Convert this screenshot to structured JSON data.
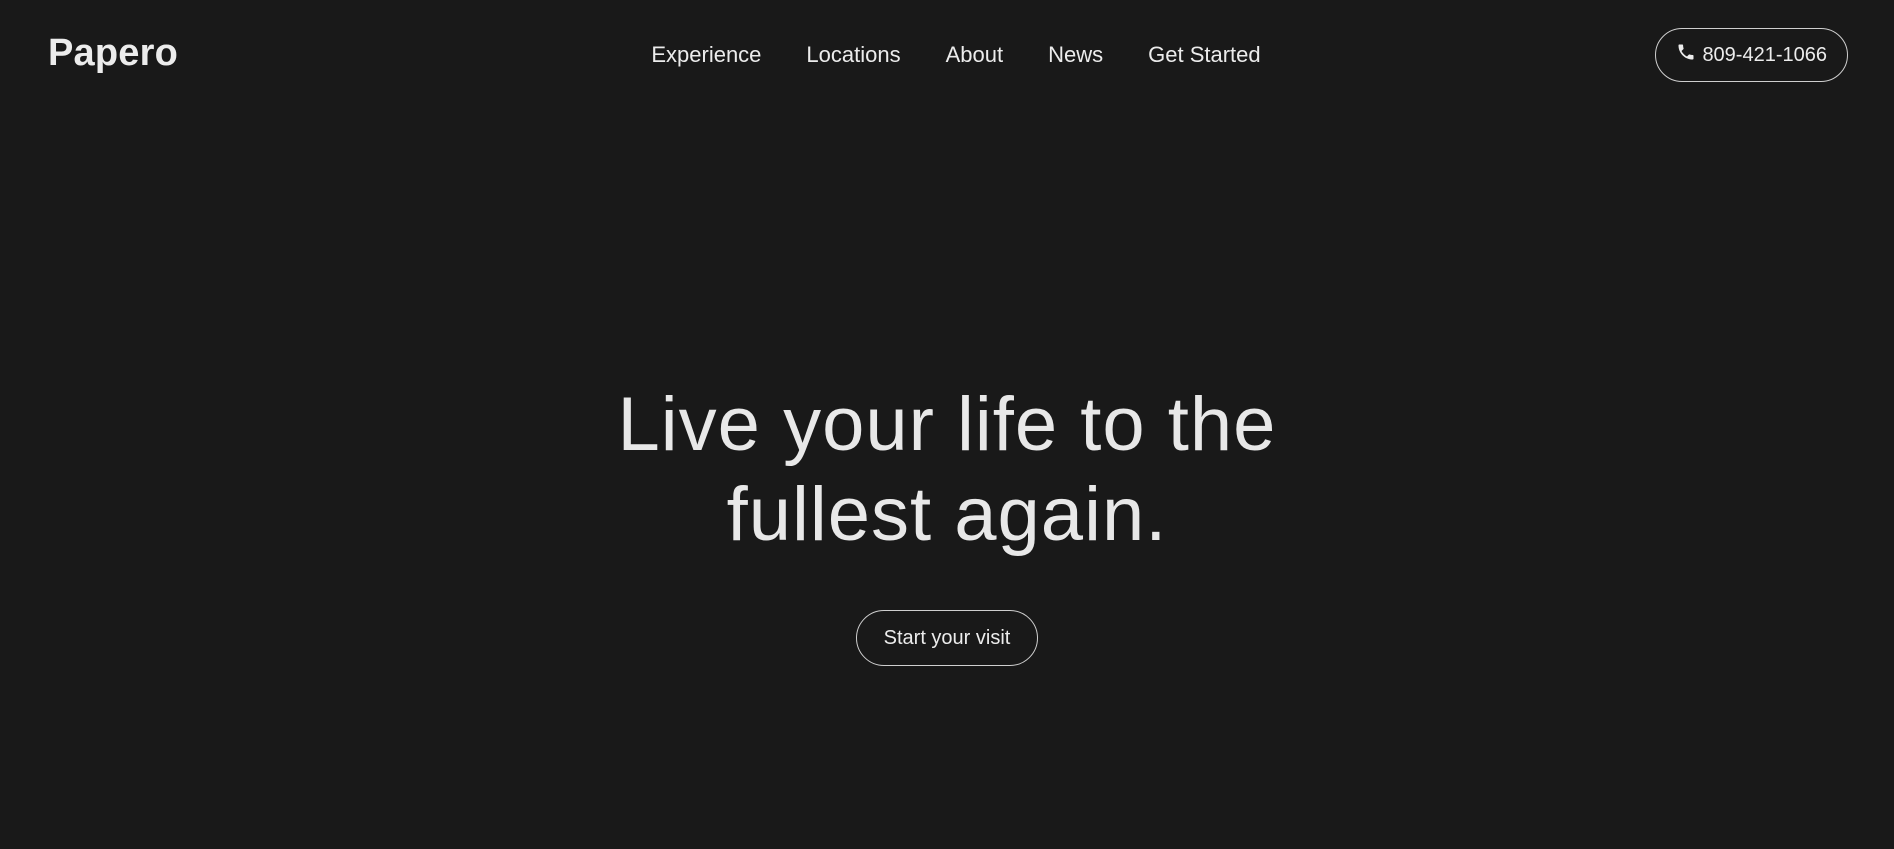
{
  "header": {
    "logo": "Papero",
    "nav": [
      {
        "label": "Experience"
      },
      {
        "label": "Locations"
      },
      {
        "label": "About"
      },
      {
        "label": "News"
      },
      {
        "label": "Get Started"
      }
    ],
    "phone": {
      "icon": "phone-icon",
      "label": "809-421-1066"
    }
  },
  "hero": {
    "title_line1": "Live your life to the",
    "title_line2": "fullest again.",
    "cta_label": "Start your visit"
  },
  "colors": {
    "background": "#191919",
    "text": "#e6e6e6",
    "border": "#cfcfcf"
  }
}
